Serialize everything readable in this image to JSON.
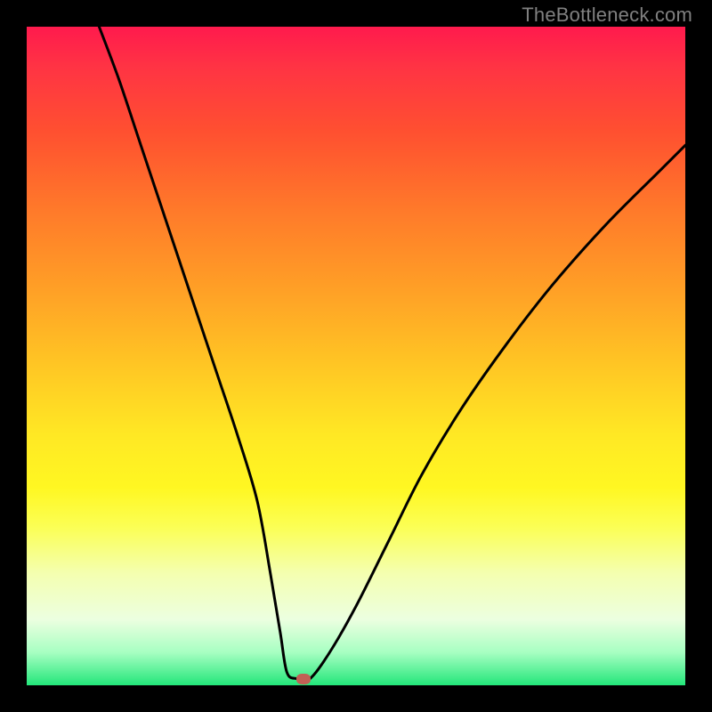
{
  "watermark": "TheBottleneck.com",
  "colors": {
    "frame_bg_top": "#ff1a4d",
    "frame_bg_bottom": "#23e67a",
    "curve_stroke": "#000000",
    "marker_fill": "#c26055",
    "page_bg": "#000000",
    "watermark_text": "#808080"
  },
  "chart_data": {
    "type": "line",
    "title": "",
    "xlabel": "",
    "ylabel": "",
    "xlim": [
      0,
      100
    ],
    "ylim": [
      0,
      100
    ],
    "grid": false,
    "legend": false,
    "series": [
      {
        "name": "curve",
        "x": [
          11,
          14,
          17,
          20,
          23,
          26,
          29,
          32,
          35,
          37,
          38.5,
          39.5,
          41,
          43,
          46,
          50,
          55,
          60,
          66,
          73,
          80,
          88,
          96,
          100
        ],
        "y": [
          100,
          92,
          83,
          74,
          65,
          56,
          47,
          38,
          28,
          17,
          8,
          2,
          1,
          1,
          5,
          12,
          22,
          32,
          42,
          52,
          61,
          70,
          78,
          82
        ]
      }
    ],
    "marker": {
      "x": 42,
      "y": 1
    },
    "notes": "V-shaped bottleneck curve on rainbow gradient; minimum near x≈41–43, y≈1. Values are visual estimates (no axis ticks shown)."
  }
}
